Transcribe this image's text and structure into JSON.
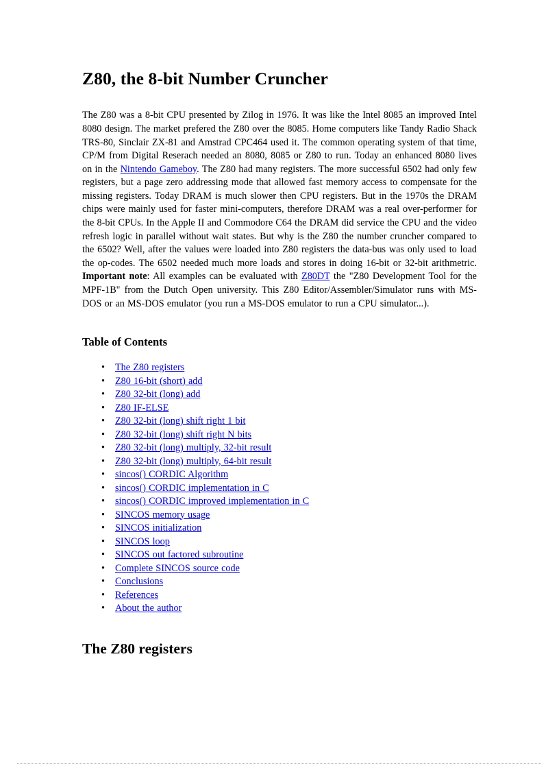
{
  "document": {
    "title": "Z80, the 8-bit Number Cruncher",
    "intro": {
      "part1": "The Z80 was a 8-bit CPU presented by Zilog in 1976. It was like the Intel 8085 an improved Intel 8080 design. The market prefered the Z80 over the 8085. Home computers like Tandy Radio Shack TRS-80, Sinclair ZX-81 and Amstrad CPC464 used it. The common operating system of that time, CP/M from Digital Reserach needed an 8080, 8085 or Z80 to run. Today an enhanced 8080 lives on in the ",
      "link_gameboy": "Nintendo Gameboy",
      "part2": ". The Z80 had many registers. The more successful 6502 had only few registers, but a page zero addressing mode that allowed fast memory access to compensate for the missing registers. Today DRAM is much slower then CPU registers. But in the 1970s the DRAM chips were mainly used for faster mini-computers, therefore DRAM was a real over-performer for the 8-bit CPUs. In the Apple II and Commodore C64 the DRAM did service the CPU and the video refresh logic in parallel without wait states. But why is the Z80 the number cruncher compared to the 6502? Well, after the values were loaded into Z80 registers the data-bus was only used to load the op-codes. The 6502 needed much more loads and stores in doing 16-bit or 32-bit arithmetric. ",
      "important_label": "Important note",
      "part3": ": All examples can be evaluated with ",
      "link_z80dt": "Z80DT",
      "part4": " the \"Z80 Development Tool for the MPF-1B\" from the Dutch Open university. This Z80 Editor/Assembler/Simulator runs with MS-DOS or an MS-DOS emulator (you run a MS-DOS emulator to run a CPU simulator...)."
    },
    "toc": {
      "heading": "Table of Contents",
      "bullet_glyph": "•",
      "items": [
        {
          "label": "The Z80 registers "
        },
        {
          "label": "Z80 16-bit (short) add"
        },
        {
          "label": "Z80 32-bit (long) add"
        },
        {
          "label": "Z80 IF-ELSE "
        },
        {
          "label": "Z80 32-bit (long) shift right 1 bit "
        },
        {
          "label": "Z80 32-bit (long) shift right N bits "
        },
        {
          "label": "Z80 32-bit (long) multiply, 32-bit result "
        },
        {
          "label": "Z80 32-bit (long) multiply, 64-bit result "
        },
        {
          "label": "sincos() CORDIC Algorithm "
        },
        {
          "label": "sincos() CORDIC implementation in C"
        },
        {
          "label": "sincos() CORDIC improved implementation in C"
        },
        {
          "label": "SINCOS memory usage "
        },
        {
          "label": "SINCOS initialization "
        },
        {
          "label": "SINCOS loop"
        },
        {
          "label": "SINCOS out factored subroutine "
        },
        {
          "label": "Complete SINCOS source code"
        },
        {
          "label": "Conclusions "
        },
        {
          "label": "References "
        },
        {
          "label": "About the author "
        }
      ]
    },
    "registers_section": {
      "heading": "The Z80 registers"
    },
    "colors": {
      "link": "#0000cc",
      "text": "#000000",
      "background": "#ffffff",
      "footer_rule": "#b8b8c4"
    }
  }
}
